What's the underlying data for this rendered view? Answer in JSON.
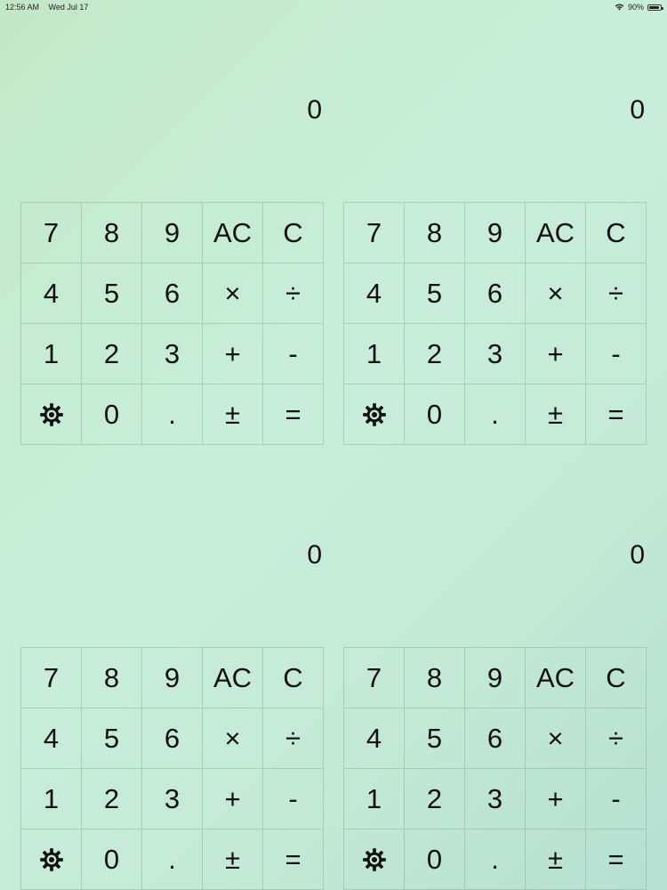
{
  "status_bar": {
    "time": "12:56 AM",
    "date": "Wed Jul 17",
    "battery": "90%",
    "battery_level": 0.9
  },
  "calculators": [
    {
      "display": "0"
    },
    {
      "display": "0"
    },
    {
      "display": "0"
    },
    {
      "display": "0"
    }
  ],
  "keys": {
    "seven": "7",
    "eight": "8",
    "nine": "9",
    "all_clear": "AC",
    "clear": "C",
    "four": "4",
    "five": "5",
    "six": "6",
    "multiply": "×",
    "divide": "÷",
    "one": "1",
    "two": "2",
    "three": "3",
    "plus": "+",
    "minus": "-",
    "settings_icon": "gear-icon",
    "zero": "0",
    "decimal": ".",
    "plus_minus": "±",
    "equals": "="
  }
}
